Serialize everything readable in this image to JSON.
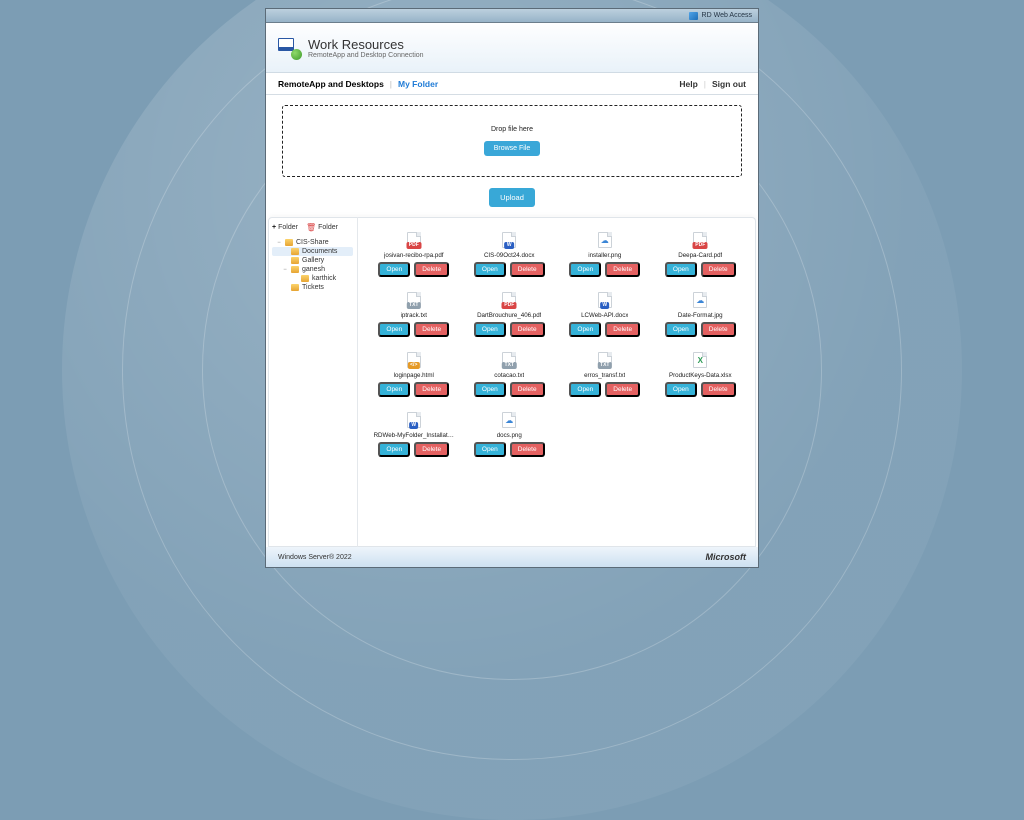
{
  "window": {
    "brand": "RD Web Access",
    "title": "Work Resources",
    "subtitle": "RemoteApp and Desktop Connection"
  },
  "tabs": {
    "main": "RemoteApp and Desktops",
    "current": "My Folder",
    "help": "Help",
    "signout": "Sign out"
  },
  "dropzone": {
    "text": "Drop file here",
    "browse": "Browse File",
    "upload": "Upload"
  },
  "sidebar": {
    "add_folder": "Folder",
    "del_folder": "Folder",
    "tree": [
      {
        "label": "CIS-Share",
        "level": 0,
        "caret": "−",
        "selected": false
      },
      {
        "label": "Documents",
        "level": 1,
        "caret": "",
        "selected": true
      },
      {
        "label": "Gallery",
        "level": 1,
        "caret": "",
        "selected": false
      },
      {
        "label": "ganesh",
        "level": 1,
        "caret": "−",
        "selected": false
      },
      {
        "label": "karthick",
        "level": 2,
        "caret": "",
        "selected": false
      },
      {
        "label": "Tickets",
        "level": 1,
        "caret": "",
        "selected": false
      }
    ]
  },
  "labels": {
    "open": "Open",
    "delete": "Delete"
  },
  "files": [
    {
      "name": "josivan-recibo-rpa.pdf",
      "type": "pdf"
    },
    {
      "name": "CIS-09Oct24.docx",
      "type": "doc"
    },
    {
      "name": "installer.png",
      "type": "img"
    },
    {
      "name": "Deepa-Card.pdf",
      "type": "pdf"
    },
    {
      "name": "iptrack.txt",
      "type": "txt"
    },
    {
      "name": "DartBrouchure_406.pdf",
      "type": "pdf"
    },
    {
      "name": "LCWeb-API.docx",
      "type": "doc"
    },
    {
      "name": "Date-Format.jpg",
      "type": "img"
    },
    {
      "name": "loginpage.html",
      "type": "html"
    },
    {
      "name": "cotacao.txt",
      "type": "txt"
    },
    {
      "name": "erros_transf.txt",
      "type": "txt"
    },
    {
      "name": "ProductKeys-Data.xlsx",
      "type": "xls"
    },
    {
      "name": "RDWeb-MyFolder_Installat…",
      "type": "doc"
    },
    {
      "name": "docs.png",
      "type": "img"
    }
  ],
  "footer": {
    "server": "Windows Server® 2022",
    "vendor": "Microsoft"
  }
}
